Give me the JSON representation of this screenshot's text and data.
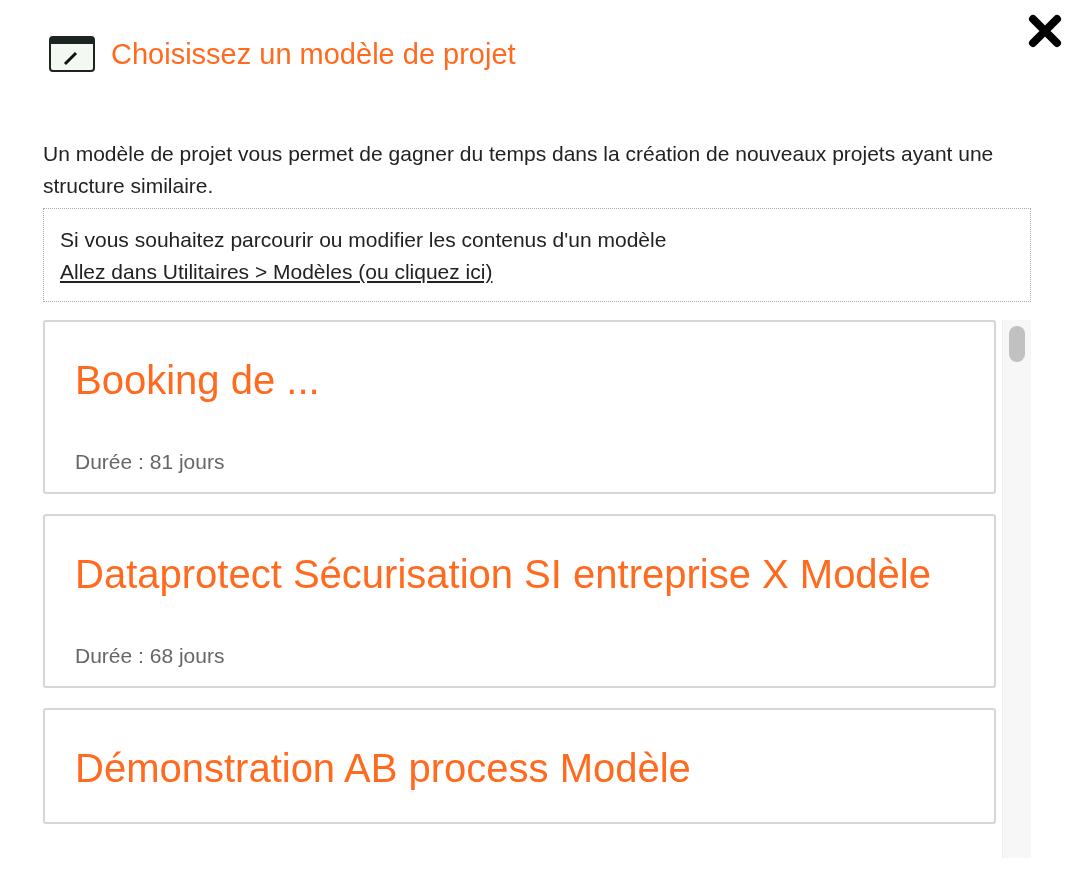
{
  "dialog": {
    "title": "Choisissez un modèle de projet",
    "description": "Un modèle de projet vous permet de gagner du temps dans la création de nouveaux projets ayant une structure similaire.",
    "info": {
      "text": "Si vous souhaitez parcourir ou modifier les contenus d'un modèle",
      "link": "Allez dans Utilitaires > Modèles (ou cliquez ici)"
    }
  },
  "templates": [
    {
      "name": "Booking de ...",
      "duration": "Durée : 81 jours"
    },
    {
      "name": "Dataprotect Sécurisation SI entreprise X Modèle",
      "duration": "Durée : 68 jours"
    },
    {
      "name": "Démonstration AB process Modèle"
    }
  ]
}
